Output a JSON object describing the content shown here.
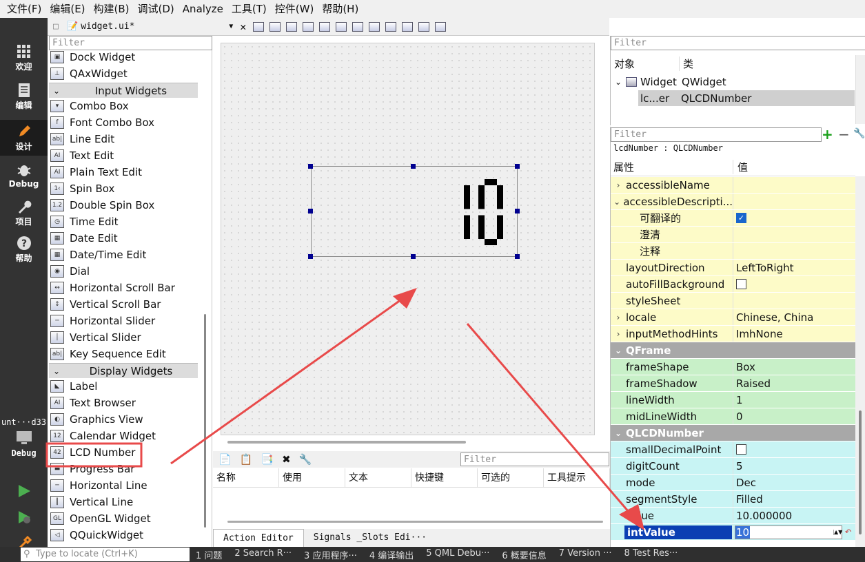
{
  "menubar": {
    "items": [
      "文件(F)",
      "编辑(E)",
      "构建(B)",
      "调试(D)",
      "Analyze",
      "工具(T)",
      "控件(W)",
      "帮助(H)"
    ]
  },
  "modes": [
    {
      "label": "欢迎",
      "icon": "grid-icon"
    },
    {
      "label": "编辑",
      "icon": "document-icon"
    },
    {
      "label": "设计",
      "icon": "pencil-icon"
    },
    {
      "label": "Debug",
      "icon": "bug-icon"
    },
    {
      "label": "项目",
      "icon": "wrench-icon"
    },
    {
      "label": "帮助",
      "icon": "help-icon"
    }
  ],
  "kit": {
    "label": "unt···d33",
    "mode": "Debug"
  },
  "document": {
    "filename": "widget.ui*"
  },
  "widgetbox": {
    "filter_placeholder": "Filter",
    "top_items": [
      "Dock Widget",
      "QAxWidget"
    ],
    "categories": [
      {
        "title": "Input Widgets",
        "items": [
          "Combo Box",
          "Font Combo Box",
          "Line Edit",
          "Text Edit",
          "Plain Text Edit",
          "Spin Box",
          "Double Spin Box",
          "Time Edit",
          "Date Edit",
          "Date/Time Edit",
          "Dial",
          "Horizontal Scroll Bar",
          "Vertical Scroll Bar",
          "Horizontal Slider",
          "Vertical Slider",
          "Key Sequence Edit"
        ]
      },
      {
        "title": "Display Widgets",
        "items": [
          "Label",
          "Text Browser",
          "Graphics View",
          "Calendar Widget",
          "LCD Number",
          "Progress Bar",
          "Horizontal Line",
          "Vertical Line",
          "OpenGL Widget",
          "QQuickWidget"
        ]
      }
    ]
  },
  "lcd": {
    "value": "10"
  },
  "action_editor": {
    "filter_placeholder": "Filter",
    "columns": [
      "名称",
      "使用",
      "文本",
      "快捷键",
      "可选的",
      "工具提示"
    ],
    "tabs": [
      "Action Editor",
      "Signals _Slots Edi···"
    ]
  },
  "object_inspector": {
    "filter_placeholder": "Filter",
    "col_object": "对象",
    "col_class": "类",
    "rows": [
      {
        "object": "Widget",
        "class": "QWidget"
      },
      {
        "object": "lc...er",
        "class": "QLCDNumber"
      }
    ]
  },
  "property_editor": {
    "filter_placeholder": "Filter",
    "object_label": "lcdNumber : QLCDNumber",
    "col_property": "属性",
    "col_value": "值",
    "rows": [
      {
        "name": "accessibleName",
        "value": "",
        "expand": "›"
      },
      {
        "name": "accessibleDescripti...",
        "value": "",
        "expand": "⌄"
      },
      {
        "name": "可翻译的",
        "value": "",
        "check": true
      },
      {
        "name": "澄清",
        "value": ""
      },
      {
        "name": "注释",
        "value": ""
      },
      {
        "name": "layoutDirection",
        "value": "LeftToRight"
      },
      {
        "name": "autoFillBackground",
        "value": "",
        "check": false
      },
      {
        "name": "styleSheet",
        "value": ""
      },
      {
        "name": "locale",
        "value": "Chinese, China",
        "expand": "›"
      },
      {
        "name": "inputMethodHints",
        "value": "ImhNone",
        "expand": "›"
      },
      {
        "name": "QFrame",
        "section": true
      },
      {
        "name": "frameShape",
        "value": "Box"
      },
      {
        "name": "frameShadow",
        "value": "Raised"
      },
      {
        "name": "lineWidth",
        "value": "1"
      },
      {
        "name": "midLineWidth",
        "value": "0"
      },
      {
        "name": "QLCDNumber",
        "section": true
      },
      {
        "name": "smallDecimalPoint",
        "value": "",
        "check": false
      },
      {
        "name": "digitCount",
        "value": "5"
      },
      {
        "name": "mode",
        "value": "Dec"
      },
      {
        "name": "segmentStyle",
        "value": "Filled"
      },
      {
        "name": "value",
        "value": "10.000000"
      },
      {
        "name": "intValue",
        "value": "10",
        "selected": true
      }
    ]
  },
  "statusbar": {
    "locate_placeholder": "Type to locate (Ctrl+K)",
    "panes": [
      "1 问题",
      "2 Search R···",
      "3 应用程序···",
      "4 编译输出",
      "5 QML Debu···",
      "6 概要信息",
      "7 Version ···",
      "8 Test Res···"
    ]
  },
  "colors": {
    "annotation": "#e84a4a",
    "selection": "#0b3fb3",
    "section": "#a8a8a8"
  }
}
